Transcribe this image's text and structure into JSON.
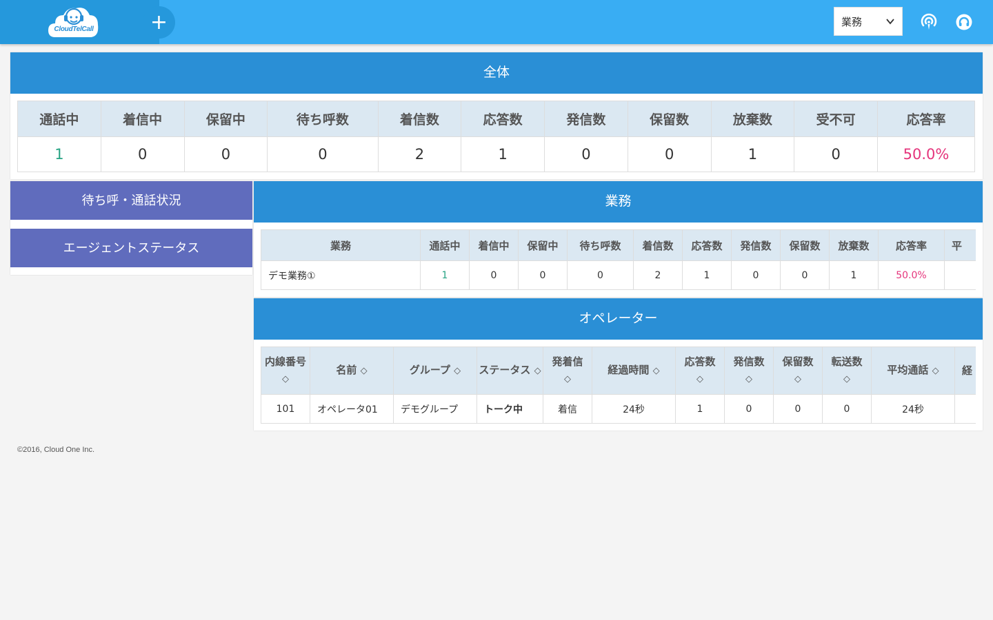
{
  "header": {
    "logo_text": "CloudTelCall",
    "add_label": "+",
    "select_value": "業務",
    "brand_color": "#2598dc",
    "accent_color": "#39adf3"
  },
  "overall": {
    "title": "全体",
    "columns": [
      "通話中",
      "着信中",
      "保留中",
      "待ち呼数",
      "着信数",
      "応答数",
      "発信数",
      "保留数",
      "放棄数",
      "受不可",
      "応答率"
    ],
    "values": [
      "1",
      "0",
      "0",
      "0",
      "2",
      "1",
      "0",
      "0",
      "1",
      "0",
      "50.0%"
    ]
  },
  "sidebar": {
    "items": [
      {
        "label": "待ち呼・通話状況"
      },
      {
        "label": "エージェントステータス"
      }
    ],
    "color": "#606cbd"
  },
  "business": {
    "title": "業務",
    "columns": [
      "業務",
      "通話中",
      "着信中",
      "保留中",
      "待ち呼数",
      "着信数",
      "応答数",
      "発信数",
      "保留数",
      "放棄数",
      "応答率",
      "平"
    ],
    "rows": [
      [
        "デモ業務①",
        "1",
        "0",
        "0",
        "0",
        "2",
        "1",
        "0",
        "0",
        "1",
        "50.0%",
        ""
      ]
    ]
  },
  "operator": {
    "title": "オペレーター",
    "columns": [
      "内線番号",
      "名前",
      "グループ",
      "ステータス",
      "発着信",
      "経過時間",
      "応答数",
      "発信数",
      "保留数",
      "転送数",
      "平均通話",
      "経"
    ],
    "sort_icon": "◇",
    "rows": [
      [
        "101",
        "オペレータ01",
        "デモグループ",
        "トーク中",
        "着信",
        "24秒",
        "1",
        "0",
        "0",
        "0",
        "24秒",
        ""
      ]
    ]
  },
  "footer": {
    "copyright": "©2016, Cloud One Inc."
  }
}
